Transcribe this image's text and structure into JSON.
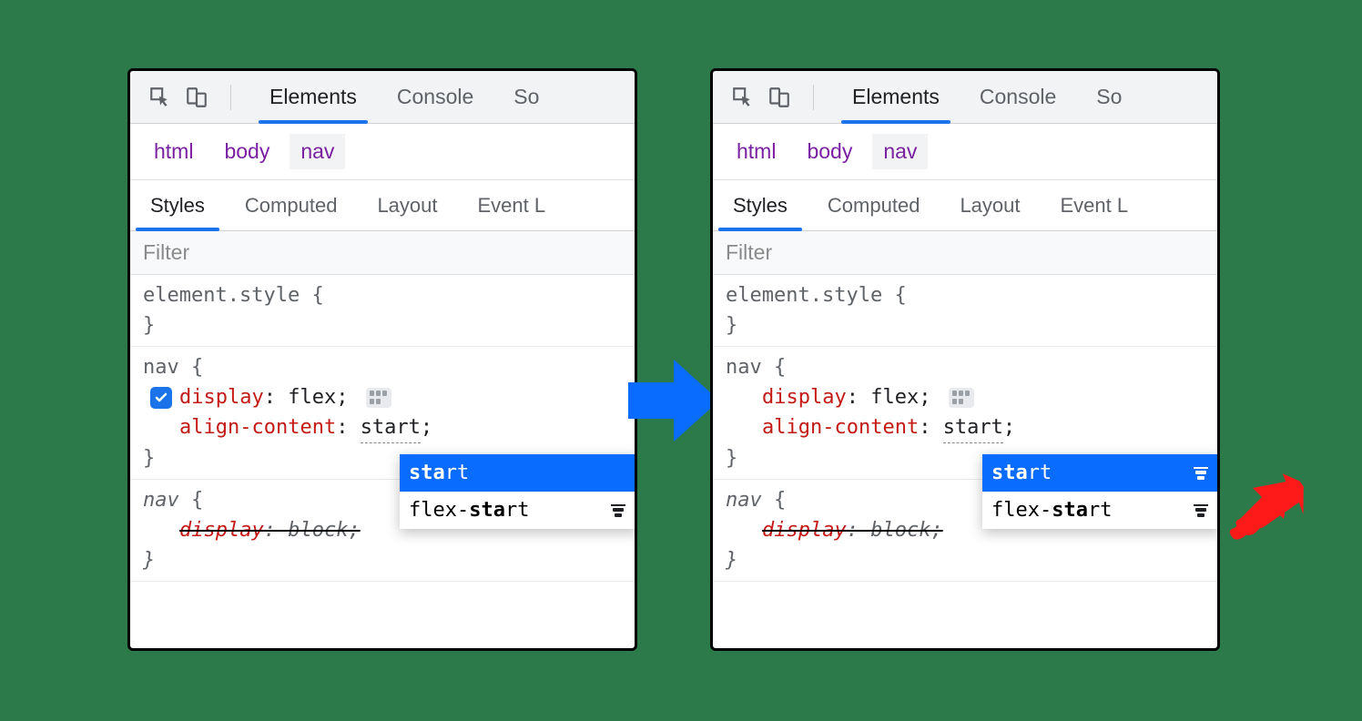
{
  "toolbar": {
    "tabs": [
      "Elements",
      "Console",
      "So"
    ],
    "active_index": 0
  },
  "breadcrumb": {
    "items": [
      "html",
      "body",
      "nav"
    ],
    "selected_index": 2
  },
  "subtabs": {
    "items": [
      "Styles",
      "Computed",
      "Layout",
      "Event L"
    ],
    "active_index": 0
  },
  "filter": {
    "placeholder": "Filter"
  },
  "element_style": {
    "selector": "element.style",
    "open": "{",
    "close": "}"
  },
  "nav_rule": {
    "selector": "nav",
    "open": "{",
    "close": "}",
    "display": {
      "prop": "display",
      "val": "flex"
    },
    "align": {
      "prop": "align-content",
      "val": "start"
    }
  },
  "ua_rule": {
    "selector": "nav",
    "open": "{",
    "close": "}",
    "display": {
      "prop": "display",
      "val": "block"
    }
  },
  "autocomplete": {
    "items": [
      {
        "prefix": "sta",
        "mid": "",
        "rest": "rt",
        "full": "start",
        "has_icon_left": false,
        "has_icon_right": true
      },
      {
        "prefix": "flex-",
        "mid": "sta",
        "rest": "rt",
        "full": "flex-start",
        "has_icon_left": false,
        "has_icon_right": false
      }
    ],
    "selected_index": 0
  }
}
